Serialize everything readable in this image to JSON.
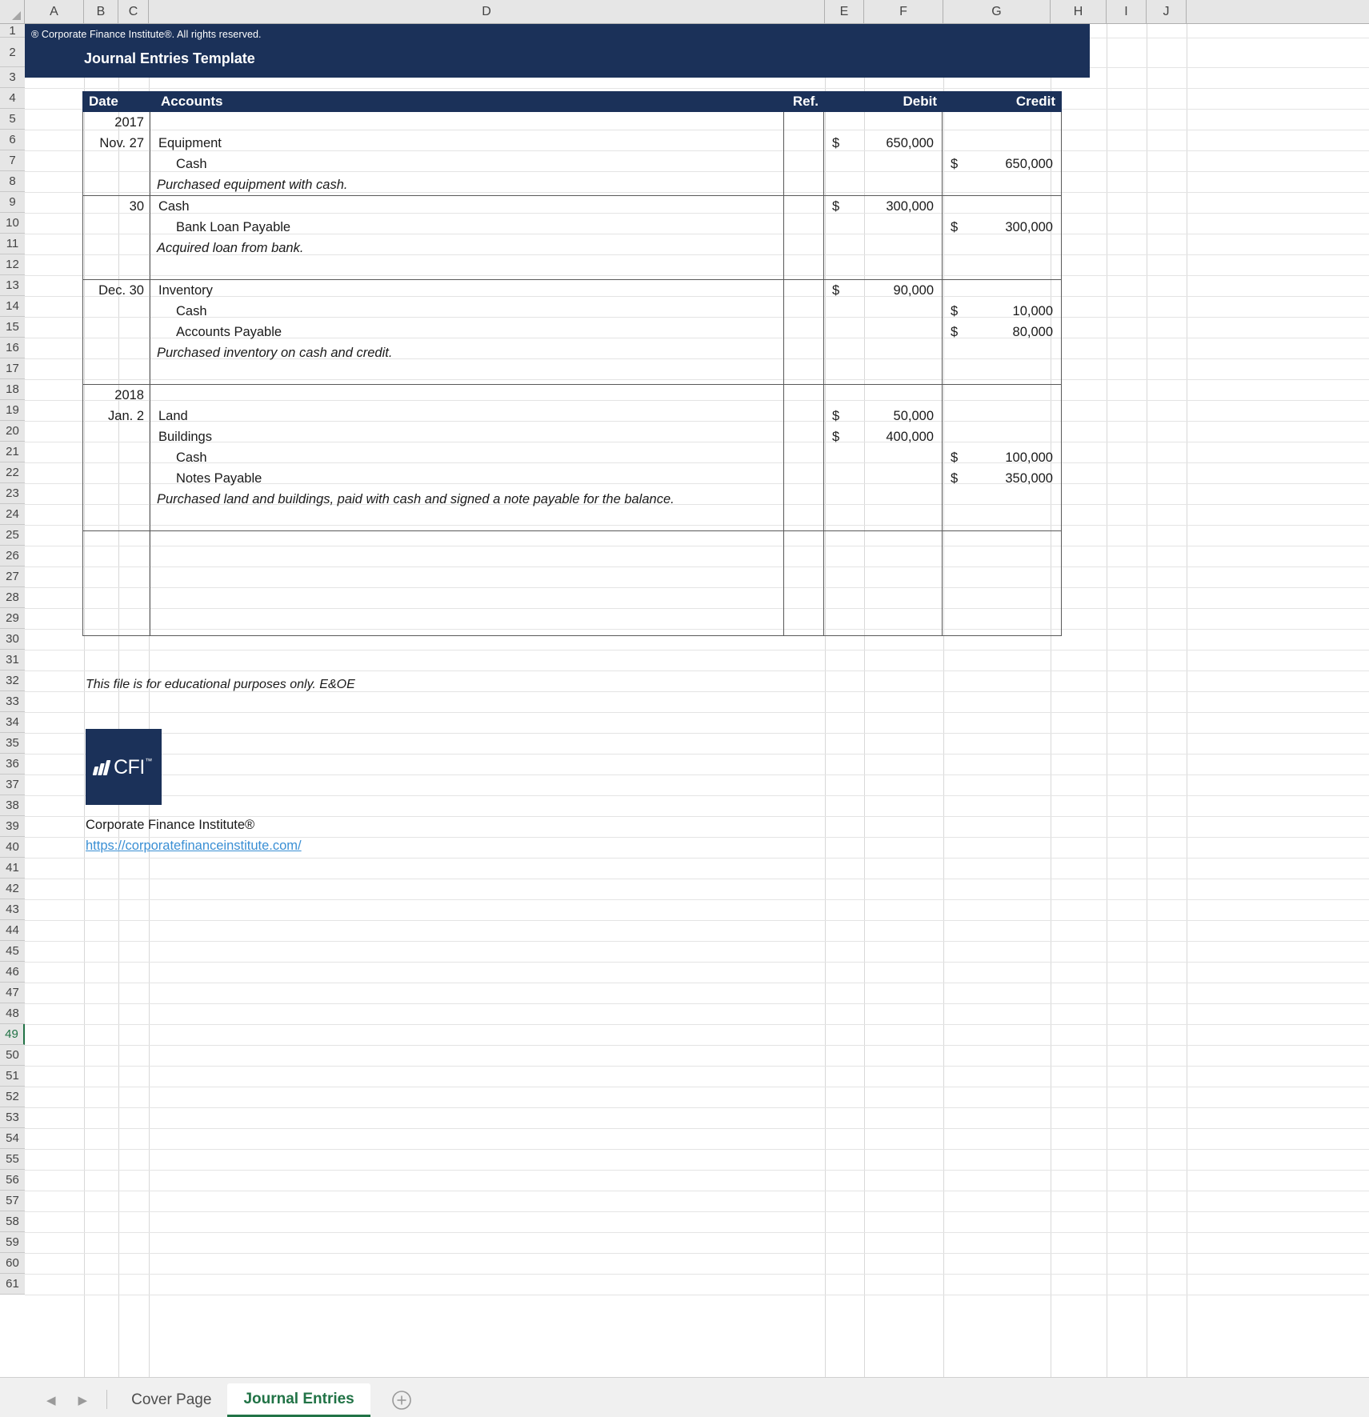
{
  "window": {
    "title": "Journal Entries Template"
  },
  "brand": {
    "copyright": "® Corporate Finance Institute®. All rights reserved.",
    "title": "Journal Entries Template",
    "navy": "#1b3159"
  },
  "grid": {
    "columns": [
      "A",
      "B",
      "C",
      "D",
      "E",
      "F",
      "G",
      "H",
      "I",
      "J"
    ],
    "rows": [
      1,
      2,
      3,
      4,
      5,
      6,
      7,
      8,
      9,
      10,
      11,
      12,
      13,
      14,
      15,
      16,
      17,
      18,
      19,
      20,
      21,
      22,
      23,
      24,
      25,
      26,
      27,
      28,
      29,
      30,
      31,
      32,
      33,
      34,
      35,
      36,
      37,
      38,
      39,
      40,
      41,
      42,
      43,
      44,
      45,
      46,
      47,
      48,
      49,
      50,
      51,
      52,
      53,
      54,
      55,
      56,
      57,
      58,
      59,
      60,
      61
    ],
    "active_row": 49
  },
  "journal": {
    "headers": {
      "date": "Date",
      "accounts": "Accounts",
      "ref": "Ref.",
      "debit": "Debit",
      "credit": "Credit"
    },
    "entries": [
      {
        "date_lines": [
          "2017",
          "Nov.  27",
          "",
          ""
        ],
        "account_lines": [
          {
            "text": "",
            "style": "empty"
          },
          {
            "text": "Equipment",
            "style": "normal"
          },
          {
            "text": "Cash",
            "style": "indent"
          },
          {
            "text": "Purchased equipment with cash.",
            "style": "memo"
          }
        ],
        "ref": "",
        "debit_lines": [
          {
            "currency": "",
            "amount": ""
          },
          {
            "currency": "$",
            "amount": "650,000"
          },
          {
            "currency": "",
            "amount": ""
          },
          {
            "currency": "",
            "amount": ""
          }
        ],
        "credit_lines": [
          {
            "currency": "",
            "amount": ""
          },
          {
            "currency": "",
            "amount": ""
          },
          {
            "currency": "$",
            "amount": "650,000"
          },
          {
            "currency": "",
            "amount": ""
          }
        ]
      },
      {
        "date_lines": [
          "30",
          "",
          "",
          ""
        ],
        "account_lines": [
          {
            "text": "Cash",
            "style": "normal"
          },
          {
            "text": "Bank Loan Payable",
            "style": "indent"
          },
          {
            "text": "Acquired loan from bank.",
            "style": "memo"
          },
          {
            "text": "",
            "style": "empty"
          }
        ],
        "ref": "",
        "debit_lines": [
          {
            "currency": "$",
            "amount": "300,000"
          },
          {
            "currency": "",
            "amount": ""
          },
          {
            "currency": "",
            "amount": ""
          },
          {
            "currency": "",
            "amount": ""
          }
        ],
        "credit_lines": [
          {
            "currency": "",
            "amount": ""
          },
          {
            "currency": "$",
            "amount": "300,000"
          },
          {
            "currency": "",
            "amount": ""
          },
          {
            "currency": "",
            "amount": ""
          }
        ]
      },
      {
        "date_lines": [
          "Dec.  30",
          "",
          "",
          "",
          ""
        ],
        "account_lines": [
          {
            "text": "Inventory",
            "style": "normal"
          },
          {
            "text": "Cash",
            "style": "indent"
          },
          {
            "text": "Accounts Payable",
            "style": "indent"
          },
          {
            "text": "Purchased inventory on cash and credit.",
            "style": "memo"
          },
          {
            "text": "",
            "style": "empty"
          }
        ],
        "ref": "",
        "debit_lines": [
          {
            "currency": "$",
            "amount": "90,000"
          },
          {
            "currency": "",
            "amount": ""
          },
          {
            "currency": "",
            "amount": ""
          },
          {
            "currency": "",
            "amount": ""
          },
          {
            "currency": "",
            "amount": ""
          }
        ],
        "credit_lines": [
          {
            "currency": "",
            "amount": ""
          },
          {
            "currency": "$",
            "amount": "10,000"
          },
          {
            "currency": "$",
            "amount": "80,000"
          },
          {
            "currency": "",
            "amount": ""
          },
          {
            "currency": "",
            "amount": ""
          }
        ]
      },
      {
        "date_lines": [
          "2018",
          "Jan.  2",
          "",
          "",
          "",
          "",
          ""
        ],
        "account_lines": [
          {
            "text": "",
            "style": "empty"
          },
          {
            "text": "Land",
            "style": "normal"
          },
          {
            "text": "Buildings",
            "style": "normal"
          },
          {
            "text": "Cash",
            "style": "indent"
          },
          {
            "text": "Notes Payable",
            "style": "indent"
          },
          {
            "text": "Purchased land and buildings, paid with cash and signed a note payable for the balance.",
            "style": "memo"
          },
          {
            "text": "",
            "style": "empty"
          }
        ],
        "ref": "",
        "debit_lines": [
          {
            "currency": "",
            "amount": ""
          },
          {
            "currency": "$",
            "amount": "50,000"
          },
          {
            "currency": "$",
            "amount": "400,000"
          },
          {
            "currency": "",
            "amount": ""
          },
          {
            "currency": "",
            "amount": ""
          },
          {
            "currency": "",
            "amount": ""
          },
          {
            "currency": "",
            "amount": ""
          }
        ],
        "credit_lines": [
          {
            "currency": "",
            "amount": ""
          },
          {
            "currency": "",
            "amount": ""
          },
          {
            "currency": "",
            "amount": ""
          },
          {
            "currency": "$",
            "amount": "100,000"
          },
          {
            "currency": "$",
            "amount": "350,000"
          },
          {
            "currency": "",
            "amount": ""
          },
          {
            "currency": "",
            "amount": ""
          }
        ]
      },
      {
        "date_lines": [
          "",
          "",
          "",
          "",
          ""
        ],
        "account_lines": [
          {
            "text": "",
            "style": "empty"
          },
          {
            "text": "",
            "style": "empty"
          },
          {
            "text": "",
            "style": "empty"
          },
          {
            "text": "",
            "style": "empty"
          },
          {
            "text": "",
            "style": "empty"
          }
        ],
        "ref": "",
        "debit_lines": [
          {
            "currency": "",
            "amount": ""
          },
          {
            "currency": "",
            "amount": ""
          },
          {
            "currency": "",
            "amount": ""
          },
          {
            "currency": "",
            "amount": ""
          },
          {
            "currency": "",
            "amount": ""
          }
        ],
        "credit_lines": [
          {
            "currency": "",
            "amount": ""
          },
          {
            "currency": "",
            "amount": ""
          },
          {
            "currency": "",
            "amount": ""
          },
          {
            "currency": "",
            "amount": ""
          },
          {
            "currency": "",
            "amount": ""
          }
        ]
      }
    ]
  },
  "footer": {
    "disclaimer": "This file is for educational purposes only. E&OE",
    "logo_text": "CFI",
    "logo_tm": "™",
    "org_name": "Corporate Finance Institute®",
    "url": "https://corporatefinanceinstitute.com/"
  },
  "tabs": {
    "prev_arrow": "◀",
    "next_arrow": "▶",
    "items": [
      {
        "label": "Cover Page",
        "active": false
      },
      {
        "label": "Journal Entries",
        "active": true
      }
    ],
    "add_label": "+"
  }
}
